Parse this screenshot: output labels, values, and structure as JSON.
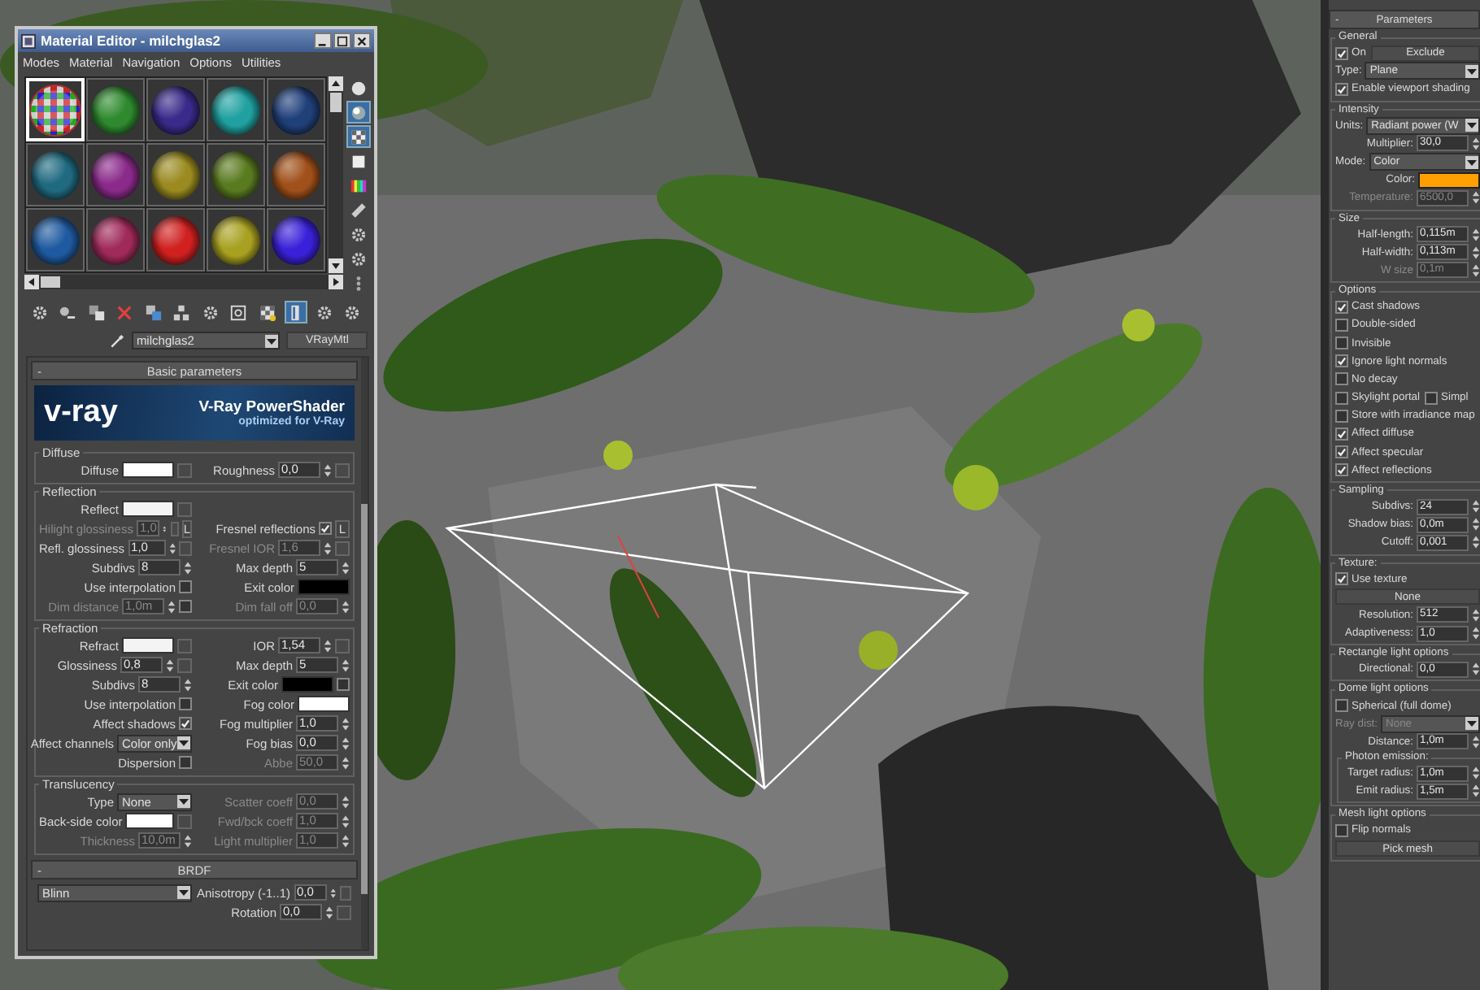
{
  "material_editor": {
    "title": "Material Editor - milchglas2",
    "menu": [
      "Modes",
      "Material",
      "Navigation",
      "Options",
      "Utilities"
    ],
    "slots": [
      {
        "kind": "checker",
        "selected": true
      },
      {
        "kind": "sphere",
        "color": "#2f8a2f",
        "selected": false
      },
      {
        "kind": "sphere",
        "color": "#3a2a8a",
        "selected": false
      },
      {
        "kind": "sphere",
        "color": "#20a0a0",
        "selected": false
      },
      {
        "kind": "sphere",
        "color": "#20407a",
        "selected": false
      },
      {
        "kind": "sphere",
        "color": "#206a80",
        "selected": false
      },
      {
        "kind": "sphere",
        "color": "#8a2a8a",
        "selected": false
      },
      {
        "kind": "sphere",
        "color": "#9a8a20",
        "selected": false
      },
      {
        "kind": "sphere",
        "color": "#5a7a20",
        "selected": false
      },
      {
        "kind": "sphere",
        "color": "#a0501a",
        "selected": false
      },
      {
        "kind": "sphere",
        "color": "#1f5aa0",
        "selected": false
      },
      {
        "kind": "sphere",
        "color": "#a02a5a",
        "selected": false
      },
      {
        "kind": "sphere",
        "color": "#d02020",
        "selected": false
      },
      {
        "kind": "sphere",
        "color": "#a8a020",
        "selected": false
      },
      {
        "kind": "sphere",
        "color": "#3a20d8",
        "selected": false
      }
    ],
    "side_tools": [
      {
        "on": false
      },
      {
        "on": true
      },
      {
        "on": true
      },
      {
        "on": false
      },
      {
        "on": false
      },
      {
        "on": false
      },
      {
        "on": false
      },
      {
        "on": false
      },
      {
        "on": false
      }
    ],
    "toolbar": [
      {
        "on": false
      },
      {
        "on": false
      },
      {
        "on": false
      },
      {
        "on": false
      },
      {
        "on": false
      },
      {
        "on": false
      },
      {
        "on": false
      },
      {
        "on": false
      },
      {
        "on": false
      },
      {
        "on": true
      },
      {
        "on": false
      },
      {
        "on": false
      }
    ],
    "material_name": "milchglas2",
    "material_type": "VRayMtl",
    "rollouts": [
      {
        "sign": "-",
        "title": "Basic parameters",
        "banner": {
          "logo": "v-ray",
          "title": "V-Ray PowerShader",
          "subtitle": "optimized for V-Ray"
        },
        "groups": [
          {
            "title": "Diffuse",
            "rows": [
              [
                {
                  "kind": "color",
                  "label": "Diffuse",
                  "color": "#ffffff",
                  "map": true
                },
                {
                  "kind": "spinner",
                  "label": "Roughness",
                  "value": "0,0",
                  "disabled": false,
                  "map": true
                }
              ]
            ]
          },
          {
            "title": "Reflection",
            "rows": [
              [
                {
                  "kind": "color",
                  "label": "Reflect",
                  "color": "#f4f4f4",
                  "map": true
                }
              ],
              [
                {
                  "kind": "spinner",
                  "label": "Hilight glossiness",
                  "value": "1,0",
                  "disabled": true,
                  "map": true,
                  "lock": "L"
                },
                {
                  "kind": "check",
                  "label": "Fresnel reflections",
                  "checked": true,
                  "lock": "L"
                }
              ],
              [
                {
                  "kind": "spinner",
                  "label": "Refl. glossiness",
                  "value": "1,0",
                  "disabled": false,
                  "map": true
                },
                {
                  "kind": "spinner",
                  "label": "Fresnel IOR",
                  "value": "1,6",
                  "disabled": true,
                  "map": true
                }
              ],
              [
                {
                  "kind": "spinner",
                  "label": "Subdivs",
                  "value": "8",
                  "disabled": false
                },
                {
                  "kind": "spinner",
                  "label": "Max depth",
                  "value": "5",
                  "disabled": false
                }
              ],
              [
                {
                  "kind": "check",
                  "label": "Use interpolation",
                  "checked": false
                },
                {
                  "kind": "color",
                  "label": "Exit color",
                  "color": "#000000"
                }
              ],
              [
                {
                  "kind": "spinner",
                  "label": "Dim distance",
                  "value": "1,0m",
                  "disabled": true,
                  "checked": false
                },
                {
                  "kind": "spinner",
                  "label": "Dim fall off",
                  "value": "0,0",
                  "disabled": true
                }
              ]
            ]
          },
          {
            "title": "Refraction",
            "rows": [
              [
                {
                  "kind": "color",
                  "label": "Refract",
                  "color": "#f4f4f4",
                  "map": true
                },
                {
                  "kind": "spinner",
                  "label": "IOR",
                  "value": "1,54",
                  "disabled": false,
                  "map": true
                }
              ],
              [
                {
                  "kind": "spinner",
                  "label": "Glossiness",
                  "value": "0,8",
                  "disabled": false,
                  "map": true
                },
                {
                  "kind": "spinner",
                  "label": "Max depth",
                  "value": "5",
                  "disabled": false
                }
              ],
              [
                {
                  "kind": "spinner",
                  "label": "Subdivs",
                  "value": "8",
                  "disabled": false
                },
                {
                  "kind": "color",
                  "label": "Exit color",
                  "color": "#000000",
                  "checked": false
                }
              ],
              [
                {
                  "kind": "check",
                  "label": "Use interpolation",
                  "checked": false
                },
                {
                  "kind": "color",
                  "label": "Fog color",
                  "color": "#ffffff"
                }
              ],
              [
                {
                  "kind": "check",
                  "label": "Affect shadows",
                  "checked": true
                },
                {
                  "kind": "spinner",
                  "label": "Fog multiplier",
                  "value": "1,0",
                  "disabled": false
                }
              ],
              [
                {
                  "kind": "dropdown",
                  "label": "Affect channels",
                  "value": "Color only",
                  "disabled": false
                },
                {
                  "kind": "spinner",
                  "label": "Fog bias",
                  "value": "0,0",
                  "disabled": false
                }
              ],
              [
                {
                  "kind": "check",
                  "label": "Dispersion",
                  "checked": false
                },
                {
                  "kind": "spinner",
                  "label": "Abbe",
                  "value": "50,0",
                  "disabled": true
                }
              ]
            ]
          },
          {
            "title": "Translucency",
            "rows": [
              [
                {
                  "kind": "dropdown",
                  "label": "Type",
                  "value": "None",
                  "disabled": false
                },
                {
                  "kind": "spinner",
                  "label": "Scatter coeff",
                  "value": "0,0",
                  "disabled": true
                }
              ],
              [
                {
                  "kind": "color",
                  "label": "Back-side color",
                  "color": "#ffffff",
                  "map": true
                },
                {
                  "kind": "spinner",
                  "label": "Fwd/bck coeff",
                  "value": "1,0",
                  "disabled": true
                }
              ],
              [
                {
                  "kind": "spinner",
                  "label": "Thickness",
                  "value": "10,0m",
                  "disabled": true
                },
                {
                  "kind": "spinner",
                  "label": "Light multiplier",
                  "value": "1,0",
                  "disabled": true
                }
              ]
            ]
          }
        ]
      },
      {
        "sign": "-",
        "title": "BRDF",
        "groups": [
          {
            "rows": [
              [
                {
                  "kind": "dropdown",
                  "value": "Blinn",
                  "disabled": false
                },
                {
                  "kind": "spinner",
                  "label": "Anisotropy (-1..1)",
                  "value": "0,0",
                  "disabled": false,
                  "map": true
                }
              ],
              [
                "",
                {
                  "kind": "spinner",
                  "label": "Rotation",
                  "value": "0,0",
                  "disabled": false,
                  "map": true
                }
              ]
            ]
          }
        ]
      }
    ]
  },
  "panel": {
    "sign": "-",
    "title": "Parameters",
    "groups": [
      {
        "title": "General",
        "rows": [
          [
            {
              "kind": "check",
              "label": "On",
              "checked": true
            },
            {
              "kind": "button",
              "label": "Exclude"
            }
          ],
          [
            {
              "kind": "dropdown",
              "label": "Type:",
              "value": "Plane",
              "disabled": false
            }
          ],
          [
            {
              "kind": "check",
              "label": "Enable viewport shading",
              "checked": true
            }
          ]
        ]
      },
      {
        "title": "Intensity",
        "rows": [
          [
            {
              "kind": "dropdown",
              "label": "Units:",
              "value": "Radiant power (W",
              "disabled": false
            }
          ],
          [
            {
              "kind": "spinner",
              "label": "Multiplier:",
              "value": "30,0",
              "disabled": false
            }
          ],
          [
            {
              "kind": "dropdown",
              "label": "Mode:",
              "value": "Color",
              "disabled": false
            }
          ],
          [
            {
              "kind": "color",
              "label": "Color:",
              "color": "#ffa000"
            }
          ],
          [
            {
              "kind": "spinner",
              "label": "Temperature:",
              "value": "6500,0",
              "disabled": true
            }
          ]
        ]
      },
      {
        "title": "Size",
        "rows": [
          [
            {
              "kind": "spinner",
              "label": "Half-length:",
              "value": "0,115m",
              "disabled": false
            }
          ],
          [
            {
              "kind": "spinner",
              "label": "Half-width:",
              "value": "0,113m",
              "disabled": false
            }
          ],
          [
            {
              "kind": "spinner",
              "label": "W size",
              "value": "0,1m",
              "disabled": true
            }
          ]
        ]
      },
      {
        "title": "Options",
        "rows": [
          [
            {
              "kind": "check",
              "label": "Cast shadows",
              "checked": true
            }
          ],
          [
            {
              "kind": "check",
              "label": "Double-sided",
              "checked": false
            }
          ],
          [
            {
              "kind": "check",
              "label": "Invisible",
              "checked": false
            }
          ],
          [
            {
              "kind": "check",
              "label": "Ignore light normals",
              "checked": true
            }
          ],
          [
            {
              "kind": "check",
              "label": "No decay",
              "checked": false
            }
          ],
          [
            {
              "kind": "check",
              "label": "Skylight portal",
              "checked": false
            },
            {
              "kind": "check",
              "label": "Simpl",
              "checked": false
            }
          ],
          [
            {
              "kind": "check",
              "label": "Store with irradiance map",
              "checked": false
            }
          ],
          [
            {
              "kind": "check",
              "label": "Affect diffuse",
              "checked": true
            }
          ],
          [
            {
              "kind": "check",
              "label": "Affect specular",
              "checked": true
            }
          ],
          [
            {
              "kind": "check",
              "label": "Affect reflections",
              "checked": true
            }
          ]
        ]
      },
      {
        "title": "Sampling",
        "rows": [
          [
            {
              "kind": "spinner",
              "label": "Subdivs:",
              "value": "24",
              "disabled": false
            }
          ],
          [
            {
              "kind": "spinner",
              "label": "Shadow bias:",
              "value": "0,0m",
              "disabled": false
            }
          ],
          [
            {
              "kind": "spinner",
              "label": "Cutoff:",
              "value": "0,001",
              "disabled": false
            }
          ]
        ]
      },
      {
        "title": "Texture:",
        "rows": [
          [
            {
              "kind": "check",
              "label": "Use texture",
              "checked": true
            }
          ],
          [
            {
              "kind": "button",
              "label": "None"
            }
          ],
          [
            {
              "kind": "spinner",
              "label": "Resolution:",
              "value": "512",
              "disabled": false
            }
          ],
          [
            {
              "kind": "spinner",
              "label": "Adaptiveness:",
              "value": "1,0",
              "disabled": false
            }
          ]
        ]
      },
      {
        "title": "Rectangle light options",
        "rows": [
          [
            {
              "kind": "spinner",
              "label": "Directional:",
              "value": "0,0",
              "disabled": false
            }
          ]
        ]
      },
      {
        "title": "Dome light options",
        "rows": [
          [
            {
              "kind": "check",
              "label": "Spherical (full dome)",
              "checked": false
            }
          ],
          [
            {
              "kind": "dropdown",
              "label": "Ray dist:",
              "value": "None",
              "disabled": true
            }
          ],
          [
            {
              "kind": "spinner",
              "label": "Distance:",
              "value": "1,0m",
              "disabled": false
            }
          ]
        ],
        "groups": [
          {
            "title": "Photon emission:",
            "rows": [
              [
                {
                  "kind": "spinner",
                  "label": "Target radius:",
                  "value": "1,0m",
                  "disabled": false
                }
              ],
              [
                {
                  "kind": "spinner",
                  "label": "Emit radius:",
                  "value": "1,5m",
                  "disabled": false
                }
              ]
            ]
          }
        ]
      },
      {
        "title": "Mesh light options",
        "rows": [
          [
            {
              "kind": "check",
              "label": "Flip normals",
              "checked": false
            }
          ],
          [
            {
              "kind": "button",
              "label": "Pick mesh"
            }
          ]
        ]
      }
    ]
  }
}
